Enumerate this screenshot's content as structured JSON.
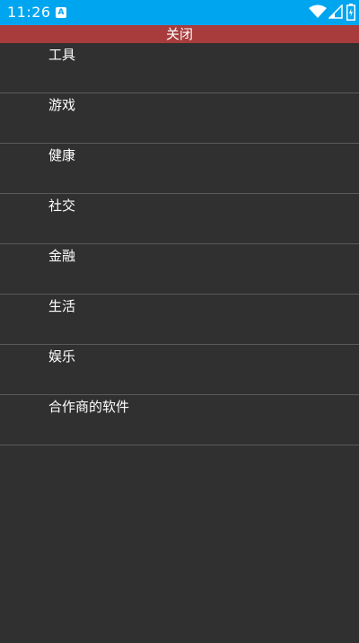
{
  "status_bar": {
    "time": "11:26",
    "notification_icon_letter": "A",
    "background_color": "#00a5f0",
    "icons": [
      "wifi-icon",
      "signal-icon",
      "battery-icon"
    ]
  },
  "close_button": {
    "label": "关闭",
    "background_color": "#a83c3c"
  },
  "menu": {
    "items": [
      {
        "label": "工具"
      },
      {
        "label": "游戏"
      },
      {
        "label": "健康"
      },
      {
        "label": "社交"
      },
      {
        "label": "金融"
      },
      {
        "label": "生活"
      },
      {
        "label": "娱乐"
      },
      {
        "label": "合作商的软件"
      }
    ]
  },
  "background_color": "#303030"
}
